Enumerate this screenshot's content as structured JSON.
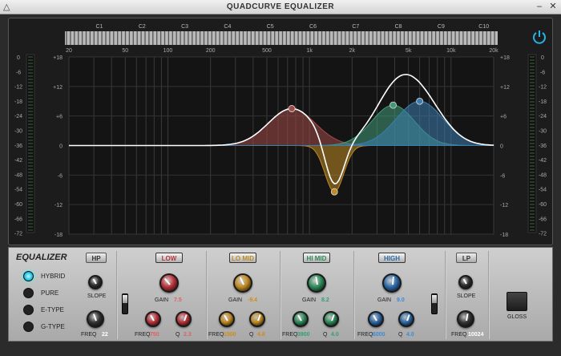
{
  "window": {
    "title": "QUADCURVE EQUALIZER",
    "min": "–",
    "close": "✕"
  },
  "keyboard": {
    "notes": [
      "C1",
      "C2",
      "C3",
      "C4",
      "C5",
      "C6",
      "C7",
      "C8",
      "C9",
      "C10"
    ]
  },
  "freq_axis": [
    "20",
    "50",
    "100",
    "200",
    "500",
    "1k",
    "2k",
    "5k",
    "10k",
    "20k"
  ],
  "db_axis": [
    "+18",
    "+12",
    "+6",
    "0",
    "-6",
    "-12",
    "-18"
  ],
  "meter_axis": [
    "0",
    "-6",
    "-12",
    "-18",
    "-24",
    "-30",
    "-36",
    "-42",
    "-48",
    "-54",
    "-60",
    "-66",
    "-72"
  ],
  "curves": {
    "low": {
      "freq_hz": 750,
      "gain_db": 7.5,
      "color": "#a34a49"
    },
    "lomid": {
      "freq_hz": 1500,
      "gain_db": -9.4,
      "color": "#c08a22"
    },
    "himid": {
      "freq_hz": 3900,
      "gain_db": 8.2,
      "color": "#3f9a78"
    },
    "high": {
      "freq_hz": 6000,
      "gain_db": 9.0,
      "color": "#3d7eb0"
    }
  },
  "panel": {
    "title": "EQUALIZER",
    "modes": [
      {
        "label": "HYBRID",
        "active": true
      },
      {
        "label": "PURE",
        "active": false
      },
      {
        "label": "E-TYPE",
        "active": false
      },
      {
        "label": "G-TYPE",
        "active": false
      }
    ],
    "gloss_label": "GLOSS",
    "hp": {
      "label": "HP",
      "slope_label": "SLOPE",
      "freq_label": "FREQ",
      "freq_value": "22",
      "slope_ticks": [
        "6",
        "12",
        "18",
        "24",
        "30",
        "36",
        "42",
        "48"
      ]
    },
    "lp": {
      "label": "LP",
      "slope_label": "SLOPE",
      "freq_label": "FREQ",
      "freq_value": "10024",
      "slope_ticks": [
        "6",
        "12",
        "18",
        "24",
        "30",
        "36",
        "42",
        "48"
      ]
    },
    "bands": [
      {
        "id": "low",
        "label": "LOW",
        "gain_label": "GAIN",
        "gain_value": "7.5",
        "freq_label": "FREQ",
        "freq_value": "750",
        "q_label": "Q",
        "q_value": "2.3",
        "color": "#b8333a",
        "btn_bg": "#c94a4a",
        "text_color": "#e06060"
      },
      {
        "id": "lomid",
        "label": "LO MID",
        "gain_label": "GAIN",
        "gain_value": "-9.4",
        "freq_label": "FREQ",
        "freq_value": "1500",
        "q_label": "Q",
        "q_value": "4.8",
        "color": "#c08a22",
        "btn_bg": "#d1a23a",
        "text_color": "#d18a10"
      },
      {
        "id": "himid",
        "label": "HI MID",
        "gain_label": "GAIN",
        "gain_value": "8.2",
        "freq_label": "FREQ",
        "freq_value": "3900",
        "q_label": "Q",
        "q_value": "4.0",
        "color": "#2e8a5a",
        "btn_bg": "#3aa068",
        "text_color": "#30a070"
      },
      {
        "id": "high",
        "label": "HIGH",
        "gain_label": "GAIN",
        "gain_value": "9.0",
        "freq_label": "FREQ",
        "freq_value": "6000",
        "q_label": "Q",
        "q_value": "4.0",
        "color": "#2e6aa8",
        "btn_bg": "#3b82c4",
        "text_color": "#3a8ad8"
      }
    ],
    "gain_ticks": [
      "0",
      "3",
      "6",
      "9",
      "12",
      "15",
      "18"
    ]
  }
}
